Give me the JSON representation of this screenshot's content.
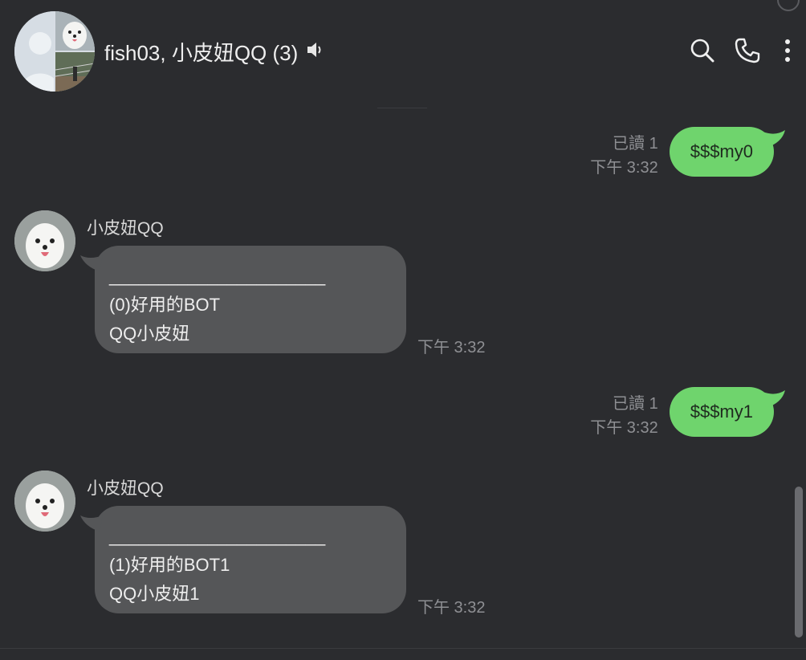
{
  "header": {
    "title": "fish03, 小皮妞QQ (3)",
    "icons": [
      "speaker-icon",
      "search-icon",
      "phone-icon",
      "more-vertical-icon"
    ]
  },
  "messages": [
    {
      "type": "outgoing",
      "read": "已讀 1",
      "time": "下午 3:32",
      "text": "$$$my0"
    },
    {
      "type": "incoming",
      "sender": "小皮妞QQ",
      "lines": [
        "______________________",
        "(0)好用的BOT",
        "QQ小皮妞"
      ],
      "time": "下午 3:32"
    },
    {
      "type": "outgoing",
      "read": "已讀 1",
      "time": "下午 3:32",
      "text": "$$$my1"
    },
    {
      "type": "incoming",
      "sender": "小皮妞QQ",
      "lines": [
        "______________________",
        "(1)好用的BOT1",
        "QQ小皮妞1"
      ],
      "time": "下午 3:32"
    }
  ],
  "colors": {
    "background": "#2b2c2f",
    "outgoing_bubble": "#6fd46d",
    "incoming_bubble": "#555658",
    "meta_text": "#8e8f93"
  }
}
